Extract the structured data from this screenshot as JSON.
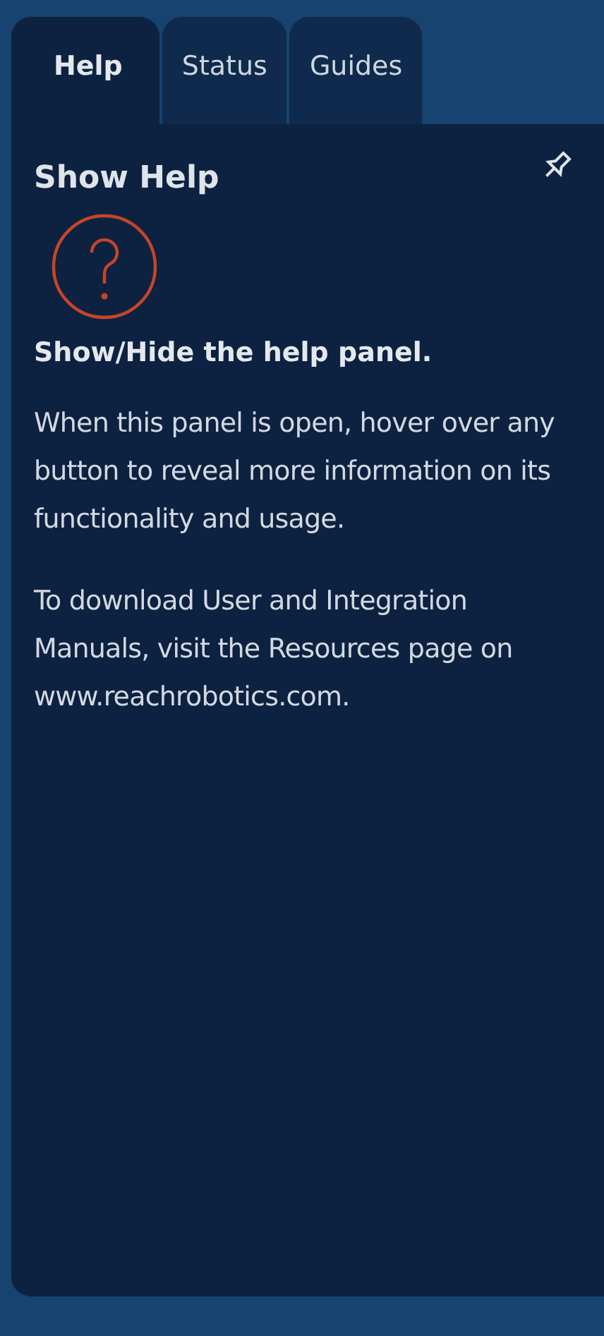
{
  "tabs": [
    {
      "label": "Help",
      "selected": true
    },
    {
      "label": "Status",
      "selected": false
    },
    {
      "label": "Guides",
      "selected": false
    }
  ],
  "panel": {
    "title": "Show Help",
    "pinned": false,
    "heading": "Show/Hide the help panel.",
    "paragraphs": [
      "When this panel is open, hover over any button to reveal more information on its functionality and usage.",
      "To download User and Integration Manuals, visit the Resources page on www.reachrobotics.com."
    ]
  }
}
